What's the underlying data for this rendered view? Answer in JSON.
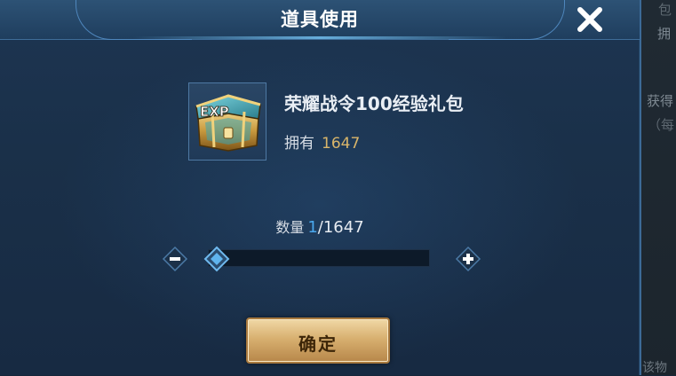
{
  "background": {
    "text_1": "包",
    "text_2": "拥",
    "text_3": "获得",
    "text_4": "（每",
    "text_5": "该物"
  },
  "dialog": {
    "title": "道具使用",
    "close_icon": "close-x-icon"
  },
  "item": {
    "name": "荣耀战令100经验礼包",
    "owned_label": "拥有",
    "owned_count": "1647",
    "icon": "exp-chest-icon",
    "icon_text": "EXP"
  },
  "quantity": {
    "label": "数量",
    "current": "1",
    "separator": "/",
    "max": "1647",
    "slider_fraction": 0.0006
  },
  "actions": {
    "confirm_label": "确定"
  },
  "colors": {
    "accent_blue": "#4aa8ee",
    "gold": "#d9b56a",
    "button_gold": "#d8b070"
  }
}
